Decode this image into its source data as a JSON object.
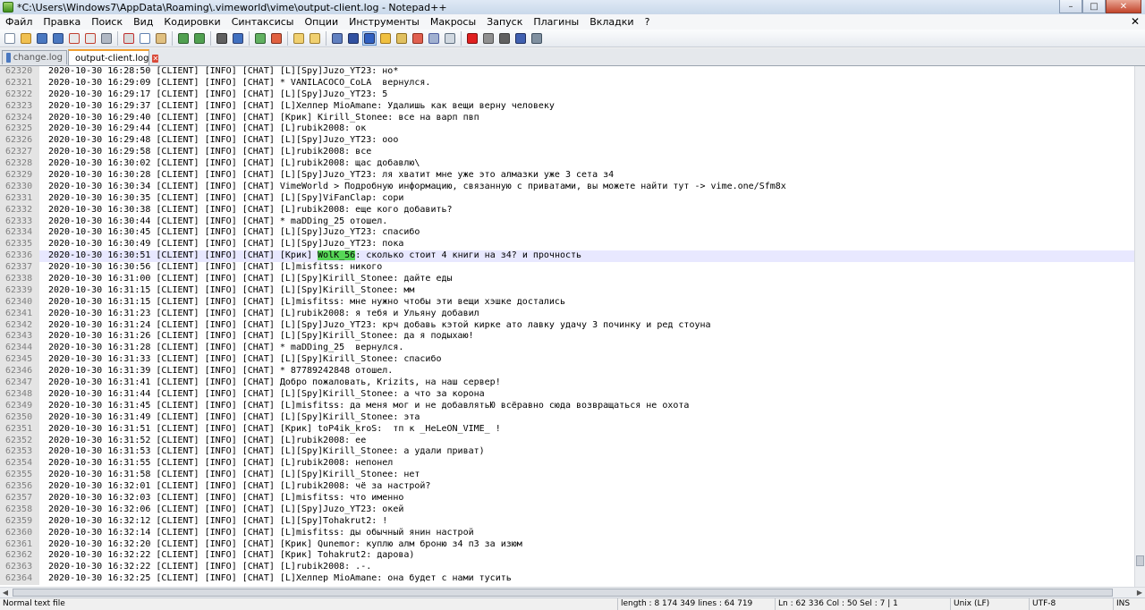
{
  "window": {
    "title": "*C:\\Users\\Windows7\\AppData\\Roaming\\.vimeworld\\vime\\output-client.log - Notepad++",
    "minimize": "–",
    "maximize": "□",
    "close": "✕"
  },
  "menu": {
    "items": [
      "Файл",
      "Правка",
      "Поиск",
      "Вид",
      "Кодировки",
      "Синтаксисы",
      "Опции",
      "Инструменты",
      "Макросы",
      "Запуск",
      "Плагины",
      "Вкладки",
      "?"
    ],
    "close": "✕"
  },
  "toolbar": {
    "buttons": [
      {
        "name": "new-file-icon",
        "color": "#ffffff",
        "border": "#7a8aa0"
      },
      {
        "name": "open-file-icon",
        "color": "#f0c050",
        "border": "#b08020"
      },
      {
        "name": "save-icon",
        "color": "#4a78c0",
        "border": "#2a4880"
      },
      {
        "name": "save-all-icon",
        "color": "#4a78c0",
        "border": "#2a4880"
      },
      {
        "name": "close-file-icon",
        "color": "#e8e8e8",
        "border": "#c04030"
      },
      {
        "name": "close-all-icon",
        "color": "#e8e8e8",
        "border": "#c04030"
      },
      {
        "name": "print-icon",
        "color": "#b0b8c4",
        "border": "#606a78"
      },
      {
        "sep": true
      },
      {
        "name": "cut-icon",
        "color": "#d8d8d8",
        "border": "#c03030"
      },
      {
        "name": "copy-icon",
        "color": "#ffffff",
        "border": "#6080b0"
      },
      {
        "name": "paste-icon",
        "color": "#e0c080",
        "border": "#907040"
      },
      {
        "sep": true
      },
      {
        "name": "undo-icon",
        "color": "#50a050",
        "border": "#306030"
      },
      {
        "name": "redo-icon",
        "color": "#50a050",
        "border": "#306030"
      },
      {
        "sep": true
      },
      {
        "name": "find-icon",
        "color": "#606060",
        "border": "#303030"
      },
      {
        "name": "replace-icon",
        "color": "#4070c0",
        "border": "#304070"
      },
      {
        "sep": true
      },
      {
        "name": "zoom-in-icon",
        "color": "#60b060",
        "border": "#306030"
      },
      {
        "name": "zoom-out-icon",
        "color": "#e06040",
        "border": "#803020"
      },
      {
        "sep": true
      },
      {
        "name": "sync-vertical-icon",
        "color": "#f0d070",
        "border": "#a08030"
      },
      {
        "name": "sync-horizontal-icon",
        "color": "#f0d070",
        "border": "#a08030"
      },
      {
        "sep": true
      },
      {
        "name": "word-wrap-icon",
        "color": "#6080c0",
        "border": "#304070"
      },
      {
        "name": "show-all-chars-icon",
        "color": "#3050a0",
        "border": "#203060"
      },
      {
        "name": "indent-guide-icon",
        "color": "#3060c0",
        "border": "#203060",
        "active": true
      },
      {
        "name": "user-language-icon",
        "color": "#f0c040",
        "border": "#a07820"
      },
      {
        "name": "doc-map-icon",
        "color": "#e0c060",
        "border": "#907020"
      },
      {
        "name": "function-list-icon",
        "color": "#e06050",
        "border": "#903020"
      },
      {
        "name": "folder-workspace-icon",
        "color": "#a0b0d0",
        "border": "#5060a0"
      },
      {
        "name": "monitoring-icon",
        "color": "#d0d8e0",
        "border": "#607080"
      },
      {
        "sep": true
      },
      {
        "name": "record-macro-icon",
        "color": "#e02020",
        "border": "#801010"
      },
      {
        "name": "stop-record-icon",
        "color": "#909090",
        "border": "#505050"
      },
      {
        "name": "playback-macro-icon",
        "color": "#606060",
        "border": "#404040"
      },
      {
        "name": "run-macro-multiple-icon",
        "color": "#4060b0",
        "border": "#203060"
      },
      {
        "name": "save-macro-icon",
        "color": "#8090a0",
        "border": "#405060"
      }
    ]
  },
  "tabs": [
    {
      "label": "change.log",
      "active": false,
      "icon_color": "#4a78c0"
    },
    {
      "label": "output-client.log",
      "active": true,
      "icon_color": "#d94a3a"
    }
  ],
  "editor": {
    "current_line": 62336,
    "selection": "WolK_56",
    "lines": [
      {
        "n": "62320",
        "t": "2020-10-30 16:28:50 [CLIENT] [INFO] [CHAT] [L][Spy]Juzo_YT23: но*"
      },
      {
        "n": "62321",
        "t": "2020-10-30 16:29:09 [CLIENT] [INFO] [CHAT] * VANILACOCO_CoLA  вернулся."
      },
      {
        "n": "62322",
        "t": "2020-10-30 16:29:17 [CLIENT] [INFO] [CHAT] [L][Spy]Juzo_YT23: 5"
      },
      {
        "n": "62323",
        "t": "2020-10-30 16:29:37 [CLIENT] [INFO] [CHAT] [L]Хелпер MioAmane: Удалишь как вещи верну человеку"
      },
      {
        "n": "62324",
        "t": "2020-10-30 16:29:40 [CLIENT] [INFO] [CHAT] [Крик] Kirill_Stonee: все на варп пвп"
      },
      {
        "n": "62325",
        "t": "2020-10-30 16:29:44 [CLIENT] [INFO] [CHAT] [L]rubik2008: ок"
      },
      {
        "n": "62326",
        "t": "2020-10-30 16:29:48 [CLIENT] [INFO] [CHAT] [L][Spy]Juzo_YT23: ооо"
      },
      {
        "n": "62327",
        "t": "2020-10-30 16:29:58 [CLIENT] [INFO] [CHAT] [L]rubik2008: все"
      },
      {
        "n": "62328",
        "t": "2020-10-30 16:30:02 [CLIENT] [INFO] [CHAT] [L]rubik2008: щас добавлю\\"
      },
      {
        "n": "62329",
        "t": "2020-10-30 16:30:28 [CLIENT] [INFO] [CHAT] [L][Spy]Juzo_YT23: ля хватит мне уже это алмазки уже 3 сета з4"
      },
      {
        "n": "62330",
        "t": "2020-10-30 16:30:34 [CLIENT] [INFO] [CHAT] VimeWorld > Подробную информацию, связанную с приватами, вы можете найти тут -> vime.one/Sfm8x"
      },
      {
        "n": "62331",
        "t": "2020-10-30 16:30:35 [CLIENT] [INFO] [CHAT] [L][Spy]ViFanClap: сори"
      },
      {
        "n": "62332",
        "t": "2020-10-30 16:30:38 [CLIENT] [INFO] [CHAT] [L]rubik2008: еще кого добавить?"
      },
      {
        "n": "62333",
        "t": "2020-10-30 16:30:44 [CLIENT] [INFO] [CHAT] * maDDing_25 отошел."
      },
      {
        "n": "62334",
        "t": "2020-10-30 16:30:45 [CLIENT] [INFO] [CHAT] [L][Spy]Juzo_YT23: спасибо"
      },
      {
        "n": "62335",
        "t": "2020-10-30 16:30:49 [CLIENT] [INFO] [CHAT] [L][Spy]Juzo_YT23: пока"
      },
      {
        "n": "62336",
        "t": "2020-10-30 16:30:51 [CLIENT] [INFO] [CHAT] [Крик] WolK_56: сколько стоит 4 книги на з4? и прочность"
      },
      {
        "n": "62337",
        "t": "2020-10-30 16:30:56 [CLIENT] [INFO] [CHAT] [L]misfitss: никого"
      },
      {
        "n": "62338",
        "t": "2020-10-30 16:31:00 [CLIENT] [INFO] [CHAT] [L][Spy]Kirill_Stonee: дайте еды"
      },
      {
        "n": "62339",
        "t": "2020-10-30 16:31:15 [CLIENT] [INFO] [CHAT] [L][Spy]Kirill_Stonee: мм"
      },
      {
        "n": "62340",
        "t": "2020-10-30 16:31:15 [CLIENT] [INFO] [CHAT] [L]misfitss: мне нужно чтобы эти вещи хэшке достались"
      },
      {
        "n": "62341",
        "t": "2020-10-30 16:31:23 [CLIENT] [INFO] [CHAT] [L]rubik2008: я тебя и Ульяну добавил"
      },
      {
        "n": "62342",
        "t": "2020-10-30 16:31:24 [CLIENT] [INFO] [CHAT] [L][Spy]Juzo_YT23: крч добавь кэтой кирке ато лавку удачу 3 починку и ред стоуна"
      },
      {
        "n": "62343",
        "t": "2020-10-30 16:31:26 [CLIENT] [INFO] [CHAT] [L][Spy]Kirill_Stonee: да я подыхаю!"
      },
      {
        "n": "62344",
        "t": "2020-10-30 16:31:28 [CLIENT] [INFO] [CHAT] * maDDing_25  вернулся."
      },
      {
        "n": "62345",
        "t": "2020-10-30 16:31:33 [CLIENT] [INFO] [CHAT] [L][Spy]Kirill_Stonee: спасибо"
      },
      {
        "n": "62346",
        "t": "2020-10-30 16:31:39 [CLIENT] [INFO] [CHAT] * 87789242848 отошел."
      },
      {
        "n": "62347",
        "t": "2020-10-30 16:31:41 [CLIENT] [INFO] [CHAT] Добро пожаловать, Krizits, на наш сервер!"
      },
      {
        "n": "62348",
        "t": "2020-10-30 16:31:44 [CLIENT] [INFO] [CHAT] [L][Spy]Kirill_Stonee: а что за корона"
      },
      {
        "n": "62349",
        "t": "2020-10-30 16:31:45 [CLIENT] [INFO] [CHAT] [L]misfitss: да меня мог и не добавлятьЮ всёравно сюда возвращаться не охота"
      },
      {
        "n": "62350",
        "t": "2020-10-30 16:31:49 [CLIENT] [INFO] [CHAT] [L][Spy]Kirill_Stonee: эта"
      },
      {
        "n": "62351",
        "t": "2020-10-30 16:31:51 [CLIENT] [INFO] [CHAT] [Крик] toP4ik_kroS:  тп к _HeLeON_VIME_ !"
      },
      {
        "n": "62352",
        "t": "2020-10-30 16:31:52 [CLIENT] [INFO] [CHAT] [L]rubik2008: ее"
      },
      {
        "n": "62353",
        "t": "2020-10-30 16:31:53 [CLIENT] [INFO] [CHAT] [L][Spy]Kirill_Stonee: а удали приват)"
      },
      {
        "n": "62354",
        "t": "2020-10-30 16:31:55 [CLIENT] [INFO] [CHAT] [L]rubik2008: непонел"
      },
      {
        "n": "62355",
        "t": "2020-10-30 16:31:58 [CLIENT] [INFO] [CHAT] [L][Spy]Kirill_Stonee: нет"
      },
      {
        "n": "62356",
        "t": "2020-10-30 16:32:01 [CLIENT] [INFO] [CHAT] [L]rubik2008: чё за настрой?"
      },
      {
        "n": "62357",
        "t": "2020-10-30 16:32:03 [CLIENT] [INFO] [CHAT] [L]misfitss: что именно"
      },
      {
        "n": "62358",
        "t": "2020-10-30 16:32:06 [CLIENT] [INFO] [CHAT] [L][Spy]Juzo_YT23: окей"
      },
      {
        "n": "62359",
        "t": "2020-10-30 16:32:12 [CLIENT] [INFO] [CHAT] [L][Spy]Tohakrut2: !"
      },
      {
        "n": "62360",
        "t": "2020-10-30 16:32:14 [CLIENT] [INFO] [CHAT] [L]misfitss: ды обычный янин настрой"
      },
      {
        "n": "62361",
        "t": "2020-10-30 16:32:20 [CLIENT] [INFO] [CHAT] [Крик] Qunemor: куплю алм броню з4 п3 за изюм"
      },
      {
        "n": "62362",
        "t": "2020-10-30 16:32:22 [CLIENT] [INFO] [CHAT] [Крик] Tohakrut2: дарова)"
      },
      {
        "n": "62363",
        "t": "2020-10-30 16:32:22 [CLIENT] [INFO] [CHAT] [L]rubik2008: .-."
      },
      {
        "n": "62364",
        "t": "2020-10-30 16:32:25 [CLIENT] [INFO] [CHAT] [L]Хелпер MioAmane: она будет с нами тусить"
      }
    ]
  },
  "scrollbar": {
    "vertical_position": 0.96,
    "vertical_size": 0.02
  },
  "statusbar": {
    "file_type": "Normal text file",
    "length": "length : 8 174 349   lines : 64 719",
    "position": "Ln : 62 336   Col : 50   Sel : 7 | 1",
    "eol": "Unix (LF)",
    "encoding": "UTF-8",
    "mode": "INS"
  }
}
